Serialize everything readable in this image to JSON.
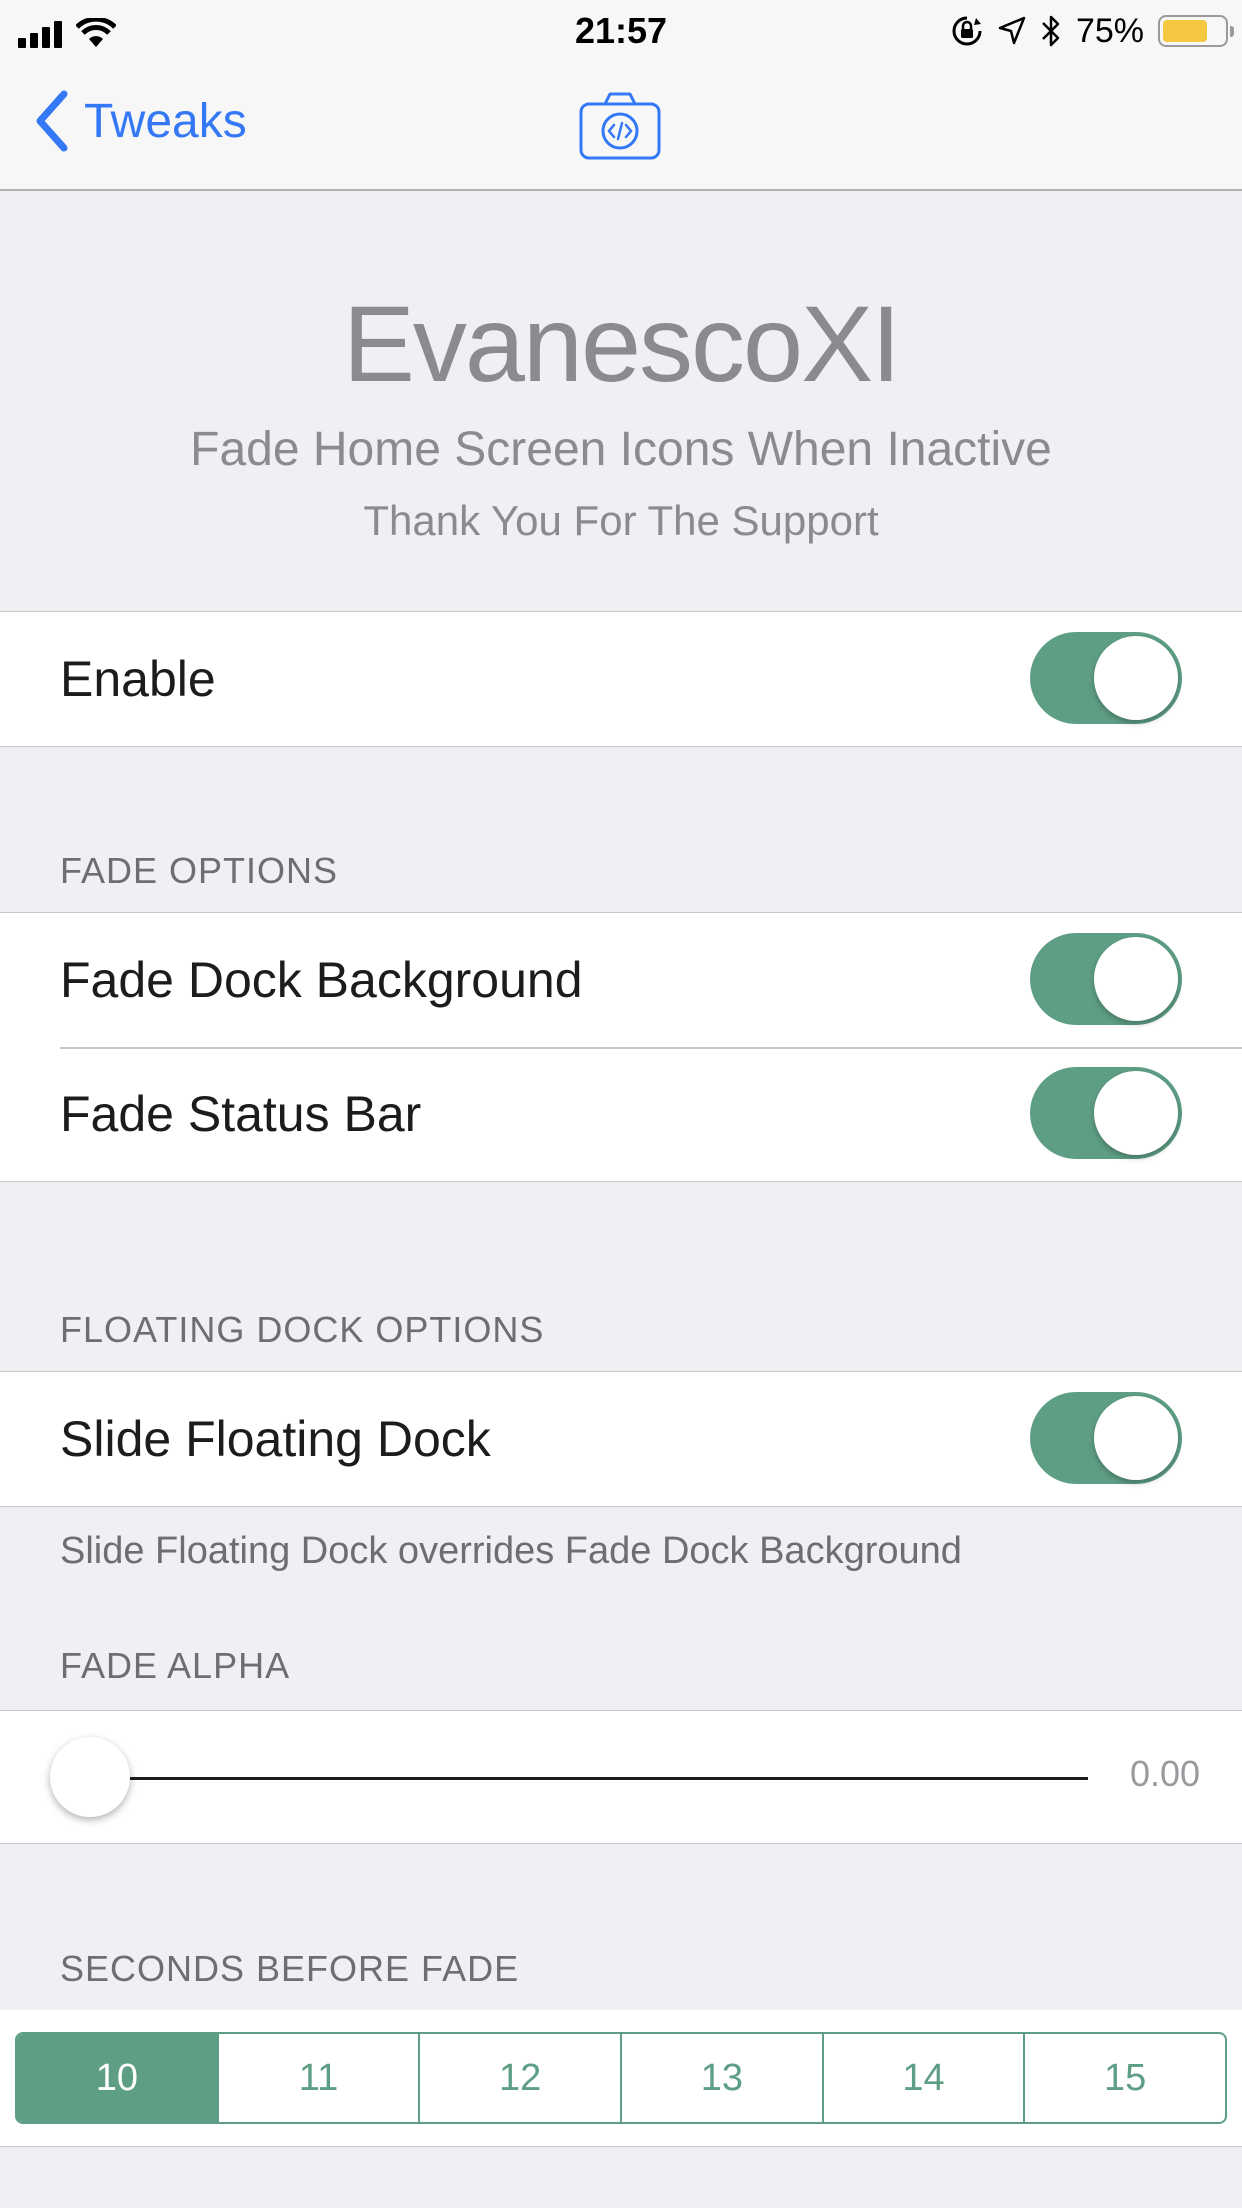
{
  "status_bar": {
    "time": "21:57",
    "battery_percent": "75%",
    "battery_level": 0.75,
    "icons": [
      "signal-icon",
      "wifi-icon",
      "orientation-lock-icon",
      "location-icon",
      "bluetooth-icon",
      "battery-icon"
    ]
  },
  "nav": {
    "back_label": "Tweaks",
    "center_icon": "camera-code-icon",
    "accent": "#3478f6"
  },
  "header": {
    "title": "EvanescoXI",
    "subtitle": "Fade Home Screen Icons When Inactive",
    "thanks": "Thank You For The Support"
  },
  "enable": {
    "label": "Enable",
    "on": true
  },
  "fade_options": {
    "header": "FADE OPTIONS",
    "rows": [
      {
        "label": "Fade Dock Background",
        "on": true
      },
      {
        "label": "Fade Status Bar",
        "on": true
      }
    ]
  },
  "floating_dock": {
    "header": "FLOATING DOCK OPTIONS",
    "row": {
      "label": "Slide Floating Dock",
      "on": true
    },
    "footer": "Slide Floating Dock overrides Fade Dock Background"
  },
  "fade_alpha": {
    "header": "FADE ALPHA",
    "value": 0.0,
    "value_text": "0.00"
  },
  "seconds_before_fade": {
    "header": "SECONDS BEFORE FADE",
    "options": [
      "10",
      "11",
      "12",
      "13",
      "14",
      "15"
    ],
    "selected": "10"
  },
  "colors": {
    "toggle_on": "#5e9e84",
    "background": "#efeff4"
  }
}
